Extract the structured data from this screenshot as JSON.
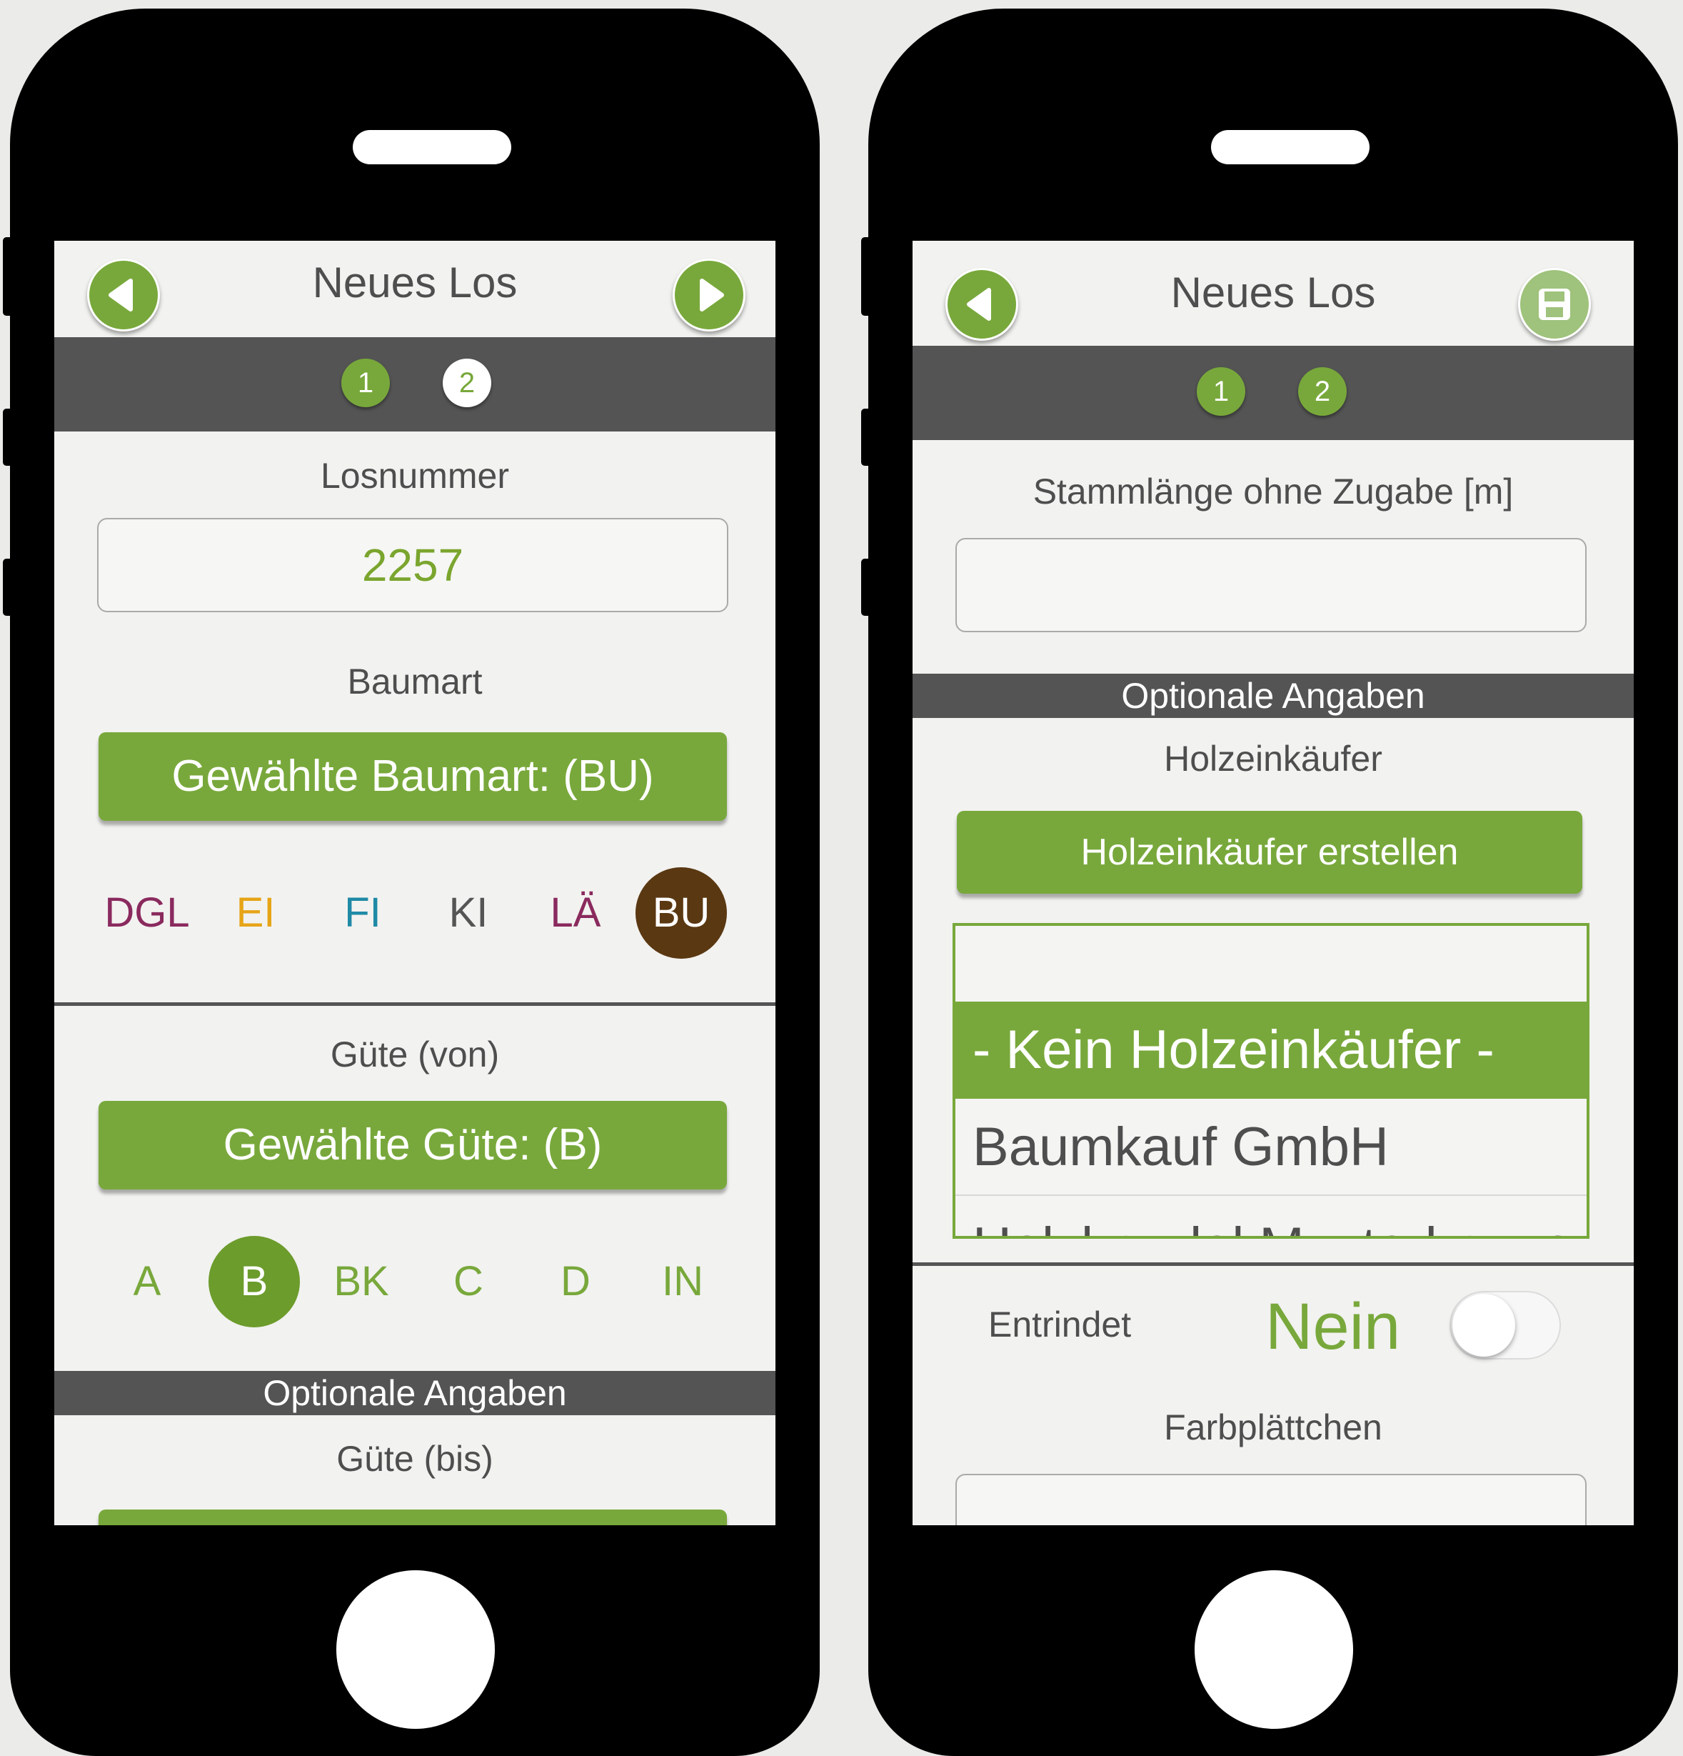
{
  "colors": {
    "accent": "#78a83b",
    "bar": "#545454",
    "text": "#4e4e4e",
    "selected_baumart": "#5a3812"
  },
  "left_screen": {
    "title": "Neues Los",
    "back_icon": "chevron-left-icon",
    "forward_icon": "chevron-right-icon",
    "steps": [
      "1",
      "2"
    ],
    "losnummer_label": "Losnummer",
    "losnummer_value": "2257",
    "baumart_label": "Baumart",
    "baumart_button": "Gewählte Baumart: (BU)",
    "baumart_options": [
      {
        "label": "DGL",
        "color": "#8a2a5e"
      },
      {
        "label": "EI",
        "color": "#e6a417"
      },
      {
        "label": "FI",
        "color": "#1f8aa6"
      },
      {
        "label": "KI",
        "color": "#555555"
      },
      {
        "label": "LÄ",
        "color": "#8a2a5e"
      },
      {
        "label": "BU",
        "color": "#ffffff",
        "selected": true
      }
    ],
    "guete_von_label": "Güte (von)",
    "guete_button": "Gewählte Güte: (B)",
    "guete_options": [
      "A",
      "B",
      "BK",
      "C",
      "D",
      "IN"
    ],
    "guete_selected": "B",
    "optional_header": "Optionale Angaben",
    "guete_bis_label": "Güte (bis)"
  },
  "right_screen": {
    "title": "Neues Los",
    "back_icon": "chevron-left-icon",
    "save_icon": "floppy-disk-icon",
    "steps": [
      "1",
      "2"
    ],
    "stammlaenge_label": "Stammlänge ohne Zugabe [m]",
    "stammlaenge_value": "",
    "optional_header": "Optionale Angaben",
    "holzeinkaeufer_label": "Holzeinkäufer",
    "create_button": "Holzeinkäufer erstellen",
    "picker_items": [
      "- Kein Holzeinkäufer -",
      "Baumkauf GmbH",
      "Holzhandel Musterhausen"
    ],
    "picker_selected_index": 0,
    "entrindet_label": "Entrindet",
    "entrindet_value": "Nein",
    "farbplaettchen_label": "Farbplättchen"
  }
}
